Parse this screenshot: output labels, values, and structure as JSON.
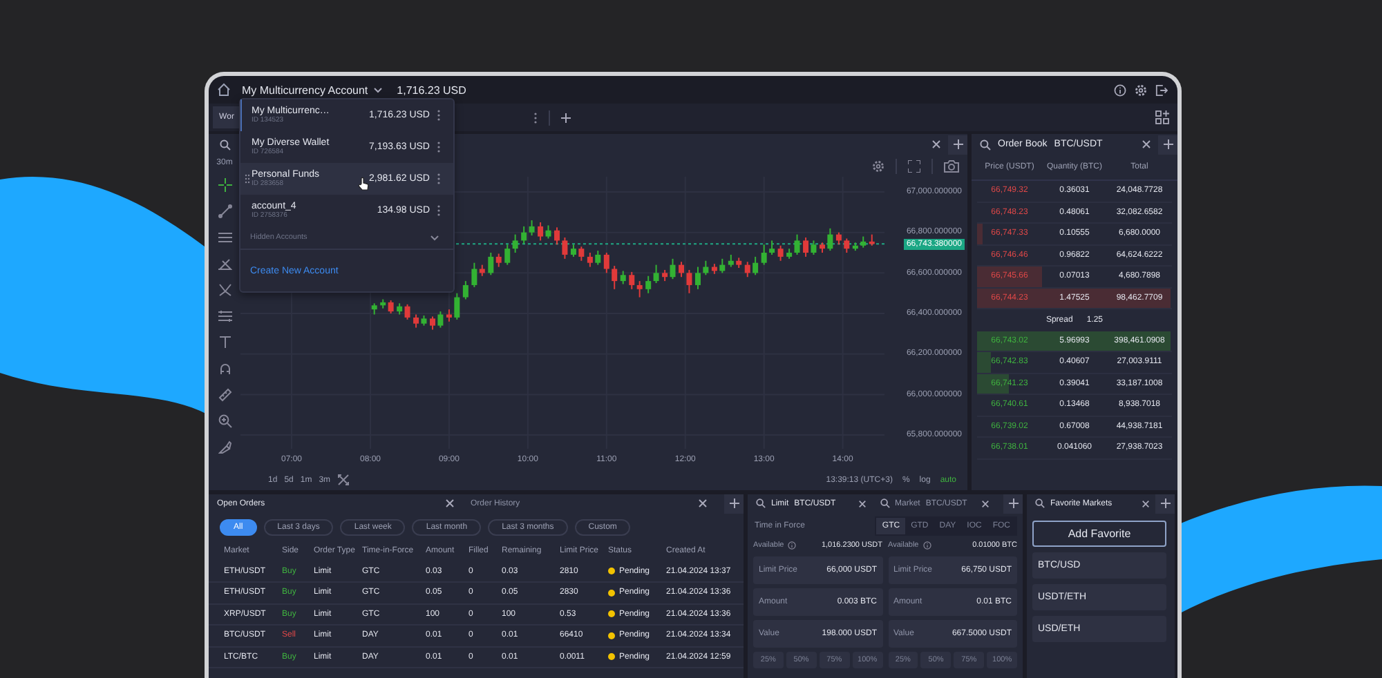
{
  "topbar": {
    "account": "My Multicurrency Account",
    "balance": "1,716.23 USD"
  },
  "workspace_tab": "Wor",
  "account_menu": {
    "accounts": [
      {
        "name": "My Multicurrenc…",
        "id": "ID 134523",
        "amount": "1,716.23 USD",
        "selected": true,
        "hovered": false
      },
      {
        "name": "My Diverse Wallet",
        "id": "ID 726584",
        "amount": "7,193.63 USD",
        "selected": false,
        "hovered": false
      },
      {
        "name": "Personal Funds",
        "id": "ID 283658",
        "amount": "2,981.62 USD",
        "selected": false,
        "hovered": true
      },
      {
        "name": "account_4",
        "id": "ID 2758376",
        "amount": "134.98 USD",
        "selected": false,
        "hovered": false
      }
    ],
    "hidden_label": "Hidden Accounts",
    "create": "Create New Account"
  },
  "chart": {
    "interval": "30m",
    "current_price": "66,743.380000",
    "chart_data": {
      "type": "candlestick",
      "yticks": [
        {
          "value": 67000,
          "label": "67,000.000000"
        },
        {
          "value": 66800,
          "label": "66,800.000000"
        },
        {
          "value": 66600,
          "label": "66,600.000000"
        },
        {
          "value": 66400,
          "label": "66,400.000000"
        },
        {
          "value": 66200,
          "label": "66,200.000000"
        },
        {
          "value": 66000,
          "label": "66,000.000000"
        },
        {
          "value": 65800,
          "label": "65,800.000000"
        }
      ],
      "xlim": [
        6.35,
        14.53
      ],
      "ylim": [
        65732,
        67075
      ],
      "xticks": [
        {
          "value": 7,
          "label": "07:00"
        },
        {
          "value": 8,
          "label": "08:00"
        },
        {
          "value": 9,
          "label": "09:00"
        },
        {
          "value": 10,
          "label": "10:00"
        },
        {
          "value": 11,
          "label": "11:00"
        },
        {
          "value": 12,
          "label": "12:00"
        },
        {
          "value": 13,
          "label": "13:00"
        },
        {
          "value": 14,
          "label": "14:00"
        }
      ],
      "x": [
        8.05,
        8.16,
        8.26,
        8.37,
        8.47,
        8.58,
        8.68,
        8.79,
        8.89,
        9.0,
        9.1,
        9.21,
        9.32,
        9.42,
        9.53,
        9.63,
        9.74,
        9.84,
        9.95,
        10.05,
        10.16,
        10.26,
        10.37,
        10.47,
        10.58,
        10.68,
        10.79,
        10.89,
        11.0,
        11.1,
        11.21,
        11.32,
        11.42,
        11.53,
        11.63,
        11.74,
        11.84,
        11.95,
        12.05,
        12.16,
        12.26,
        12.37,
        12.47,
        12.58,
        12.68,
        12.79,
        12.89,
        13.0,
        13.1,
        13.21,
        13.32,
        13.42,
        13.53,
        13.63,
        13.74,
        13.84,
        13.95,
        14.05,
        14.16,
        14.26,
        14.37
      ],
      "grid": true,
      "ref_lines": [
        {
          "axis": "y",
          "value": 66743.38,
          "color": "#1fa884"
        }
      ],
      "ohlc": [
        [
          66420,
          66450,
          66395,
          66440
        ],
        [
          66440,
          66470,
          66425,
          66455
        ],
        [
          66455,
          66465,
          66400,
          66410
        ],
        [
          66410,
          66450,
          66395,
          66435
        ],
        [
          66435,
          66445,
          66370,
          66380
        ],
        [
          66380,
          66395,
          66330,
          66350
        ],
        [
          66350,
          66390,
          66340,
          66375
        ],
        [
          66375,
          66385,
          66320,
          66340
        ],
        [
          66340,
          66410,
          66330,
          66395
        ],
        [
          66395,
          66420,
          66360,
          66380
        ],
        [
          66380,
          66500,
          66370,
          66480
        ],
        [
          66480,
          66560,
          66470,
          66540
        ],
        [
          66540,
          66650,
          66530,
          66620
        ],
        [
          66620,
          66640,
          66585,
          66600
        ],
        [
          66600,
          66700,
          66590,
          66680
        ],
        [
          66680,
          66695,
          66630,
          66650
        ],
        [
          66650,
          66740,
          66640,
          66720
        ],
        [
          66720,
          66790,
          66700,
          66760
        ],
        [
          66760,
          66830,
          66745,
          66800
        ],
        [
          66800,
          66860,
          66785,
          66830
        ],
        [
          66830,
          66850,
          66760,
          66780
        ],
        [
          66780,
          66835,
          66770,
          66810
        ],
        [
          66810,
          66825,
          66740,
          66760
        ],
        [
          66760,
          66775,
          66670,
          66690
        ],
        [
          66690,
          66740,
          66680,
          66720
        ],
        [
          66720,
          66730,
          66660,
          66680
        ],
        [
          66680,
          66700,
          66630,
          66650
        ],
        [
          66650,
          66710,
          66640,
          66690
        ],
        [
          66690,
          66700,
          66600,
          66620
        ],
        [
          66620,
          66635,
          66520,
          66560
        ],
        [
          66560,
          66610,
          66545,
          66590
        ],
        [
          66590,
          66605,
          66520,
          66540
        ],
        [
          66540,
          66560,
          66480,
          66520
        ],
        [
          66520,
          66585,
          66500,
          66560
        ],
        [
          66560,
          66640,
          66550,
          66600
        ],
        [
          66600,
          66615,
          66560,
          66580
        ],
        [
          66580,
          66670,
          66570,
          66640
        ],
        [
          66640,
          66655,
          66580,
          66600
        ],
        [
          66600,
          66615,
          66500,
          66540
        ],
        [
          66540,
          66630,
          66520,
          66600
        ],
        [
          66600,
          66660,
          66590,
          66630
        ],
        [
          66630,
          66645,
          66595,
          66610
        ],
        [
          66610,
          66670,
          66600,
          66640
        ],
        [
          66640,
          66690,
          66630,
          66660
        ],
        [
          66660,
          66675,
          66625,
          66640
        ],
        [
          66640,
          66655,
          66580,
          66600
        ],
        [
          66600,
          66680,
          66590,
          66650
        ],
        [
          66650,
          66740,
          66640,
          66700
        ],
        [
          66700,
          66760,
          66690,
          66720
        ],
        [
          66720,
          66735,
          66660,
          66680
        ],
        [
          66680,
          66720,
          66670,
          66700
        ],
        [
          66700,
          66790,
          66690,
          66760
        ],
        [
          66760,
          66775,
          66680,
          66700
        ],
        [
          66700,
          66760,
          66690,
          66740
        ],
        [
          66740,
          66750,
          66700,
          66720
        ],
        [
          66720,
          66820,
          66710,
          66790
        ],
        [
          66790,
          66800,
          66740,
          66760
        ],
        [
          66760,
          66770,
          66700,
          66720
        ],
        [
          66720,
          66750,
          66710,
          66735
        ],
        [
          66735,
          66780,
          66725,
          66755
        ],
        [
          66755,
          66790,
          66735,
          66743
        ]
      ]
    },
    "ranges": [
      "1d",
      "5d",
      "1m",
      "3m"
    ],
    "clock": "13:39:13 (UTC+3)",
    "scale_options": [
      {
        "label": "%",
        "selected": false
      },
      {
        "label": "log",
        "selected": false
      },
      {
        "label": "auto",
        "selected": true
      }
    ]
  },
  "order_book": {
    "title": "Order Book",
    "pair": "BTC/USDT",
    "columns": [
      "Price (USDT)",
      "Quantity (BTC)",
      "Total"
    ],
    "asks": [
      {
        "price": "66,749.32",
        "quantity": "0.36031",
        "total": "24,048.7728"
      },
      {
        "price": "66,748.23",
        "quantity": "0.48061",
        "total": "32,082.6582"
      },
      {
        "price": "66,747.33",
        "quantity": "0.10555",
        "total": "6,680.0000",
        "level": 0.03
      },
      {
        "price": "66,746.46",
        "quantity": "0.96822",
        "total": "64,624.6222"
      },
      {
        "price": "66,745.66",
        "quantity": "0.07013",
        "total": "4,680.7898",
        "level": 0.33
      },
      {
        "price": "66,744.23",
        "quantity": "1.47525",
        "total": "98,462.7709",
        "level": 0.99
      }
    ],
    "spread_label": "Spread",
    "spread": "1.25",
    "bids": [
      {
        "price": "66,743.02",
        "quantity": "5.96993",
        "total": "398,461.0908",
        "level": 0.99
      },
      {
        "price": "66,742.83",
        "quantity": "0.40607",
        "total": "27,003.9111",
        "level": 0.07
      },
      {
        "price": "66,741.23",
        "quantity": "0.39041",
        "total": "33,187.1008",
        "level": 0.16
      },
      {
        "price": "66,740.61",
        "quantity": "0.13468",
        "total": "8,938.7018"
      },
      {
        "price": "66,739.02",
        "quantity": "0.67008",
        "total": "44,938.7181"
      },
      {
        "price": "66,738.01",
        "quantity": "0.041060",
        "total": "27,938.7023"
      }
    ]
  },
  "orders": {
    "tabs": [
      {
        "label": "Open Orders",
        "selected": true
      },
      {
        "label": "Order History",
        "selected": false
      }
    ],
    "filters": [
      {
        "label": "All",
        "selected": true
      },
      {
        "label": "Last 3 days",
        "selected": false
      },
      {
        "label": "Last week",
        "selected": false
      },
      {
        "label": "Last month",
        "selected": false
      },
      {
        "label": "Last 3 months",
        "selected": false
      },
      {
        "label": "Custom",
        "selected": false
      }
    ],
    "columns": [
      "Market",
      "Side",
      "Order Type",
      "Time-in-Force",
      "Amount",
      "Filled",
      "Remaining",
      "Limit Price",
      "Status",
      "Created At"
    ],
    "rows": [
      {
        "market": "ETH/USDT",
        "side": "Buy",
        "kind": "buy",
        "order_type": "Limit",
        "tif": "GTC",
        "amount": "0.03",
        "filled": "0",
        "remaining": "0.03",
        "limit_price": "2810",
        "status": "Pending",
        "color": "#f2c200",
        "created": "21.04.2024 13:37"
      },
      {
        "market": "ETH/USDT",
        "side": "Buy",
        "kind": "buy",
        "order_type": "Limit",
        "tif": "GTC",
        "amount": "0.05",
        "filled": "0",
        "remaining": "0.05",
        "limit_price": "2830",
        "status": "Pending",
        "color": "#f2c200",
        "created": "21.04.2024 13:36"
      },
      {
        "market": "XRP/USDT",
        "side": "Buy",
        "kind": "buy",
        "order_type": "Limit",
        "tif": "GTC",
        "amount": "100",
        "filled": "0",
        "remaining": "100",
        "limit_price": "0.53",
        "status": "Pending",
        "color": "#f2c200",
        "created": "21.04.2024 13:36"
      },
      {
        "market": "BTC/USDT",
        "side": "Sell",
        "kind": "sell",
        "order_type": "Limit",
        "tif": "DAY",
        "amount": "0.01",
        "filled": "0",
        "remaining": "0.01",
        "limit_price": "66410",
        "status": "Pending",
        "color": "#f2c200",
        "created": "21.04.2024 13:34"
      },
      {
        "market": "LTC/BTC",
        "side": "Buy",
        "kind": "buy",
        "order_type": "Limit",
        "tif": "DAY",
        "amount": "0.01",
        "filled": "0",
        "remaining": "0.01",
        "limit_price": "0.0011",
        "status": "Pending",
        "color": "#f2c200",
        "created": "21.04.2024 12:59"
      }
    ]
  },
  "trade": {
    "tabs": [
      {
        "label": "Limit",
        "pair": "BTC/USDT",
        "selected": true
      },
      {
        "label": "Market",
        "pair": "BTC/USDT",
        "selected": false
      }
    ],
    "tif_label": "Time in Force",
    "tif_options": [
      {
        "label": "GTC",
        "selected": true
      },
      {
        "label": "GTD",
        "selected": false
      },
      {
        "label": "DAY",
        "selected": false
      },
      {
        "label": "IOC",
        "selected": false
      },
      {
        "label": "FOC",
        "selected": false
      }
    ],
    "forms": [
      {
        "available_label": "Available",
        "available": "1,016.2300 USDT",
        "fields": [
          {
            "label": "Limit Price",
            "value": "66,000 USDT"
          },
          {
            "label": "Amount",
            "value": "0.003 BTC"
          },
          {
            "label": "Value",
            "value": "198.000 USDT"
          }
        ],
        "percents": [
          "25%",
          "50%",
          "75%",
          "100%"
        ]
      },
      {
        "available_label": "Available",
        "available": "0.01000 BTC",
        "fields": [
          {
            "label": "Limit Price",
            "value": "66,750 USDT"
          },
          {
            "label": "Amount",
            "value": "0.01 BTC"
          },
          {
            "label": "Value",
            "value": "667.5000 USDT"
          }
        ],
        "percents": [
          "25%",
          "50%",
          "75%",
          "100%"
        ]
      }
    ]
  },
  "favorites": {
    "title": "Favorite Markets",
    "add": "Add Favorite",
    "markets": [
      "BTC/USD",
      "USDT/ETH",
      "USD/ETH"
    ]
  }
}
